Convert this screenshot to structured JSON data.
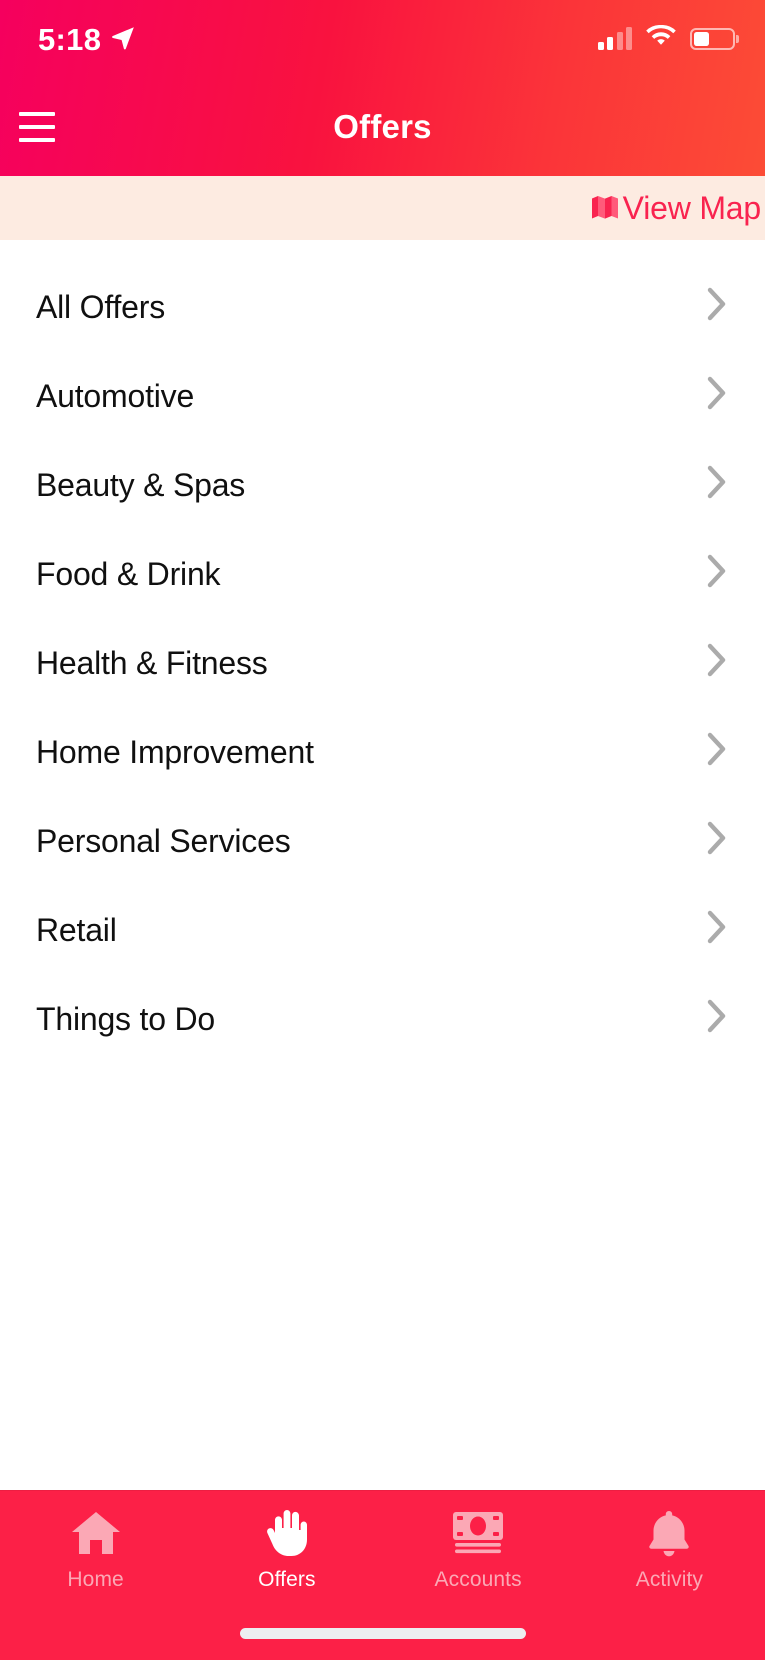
{
  "status_bar": {
    "time": "5:18",
    "location_icon": "location-arrow-icon",
    "signal_icon": "cellular-signal-icon",
    "signal_bars_filled": 2,
    "signal_bars_total": 4,
    "wifi_icon": "wifi-icon",
    "battery_icon": "battery-icon",
    "battery_level_percent": 41
  },
  "header": {
    "title": "Offers",
    "menu_icon": "hamburger-menu-icon",
    "gradient_start": "#F5005E",
    "gradient_end": "#FC4C36"
  },
  "view_map_bar": {
    "label": "View Map",
    "icon": "folded-map-icon",
    "background": "#FDEBE1",
    "text_color": "#F9234F"
  },
  "categories": {
    "chevron_icon": "chevron-right-icon",
    "items": [
      {
        "label": "All Offers"
      },
      {
        "label": "Automotive"
      },
      {
        "label": "Beauty & Spas"
      },
      {
        "label": "Food & Drink"
      },
      {
        "label": "Health & Fitness"
      },
      {
        "label": "Home Improvement"
      },
      {
        "label": "Personal Services"
      },
      {
        "label": "Retail"
      },
      {
        "label": "Things to Do"
      }
    ]
  },
  "tab_bar": {
    "background": "#FC2047",
    "active_color": "#FFFFFF",
    "inactive_color": "#FBA8B5",
    "tabs": [
      {
        "label": "Home",
        "icon": "house-icon",
        "active": false
      },
      {
        "label": "Offers",
        "icon": "hand-icon",
        "active": true
      },
      {
        "label": "Accounts",
        "icon": "banknote-icon",
        "active": false
      },
      {
        "label": "Activity",
        "icon": "bell-icon",
        "active": false
      }
    ]
  }
}
